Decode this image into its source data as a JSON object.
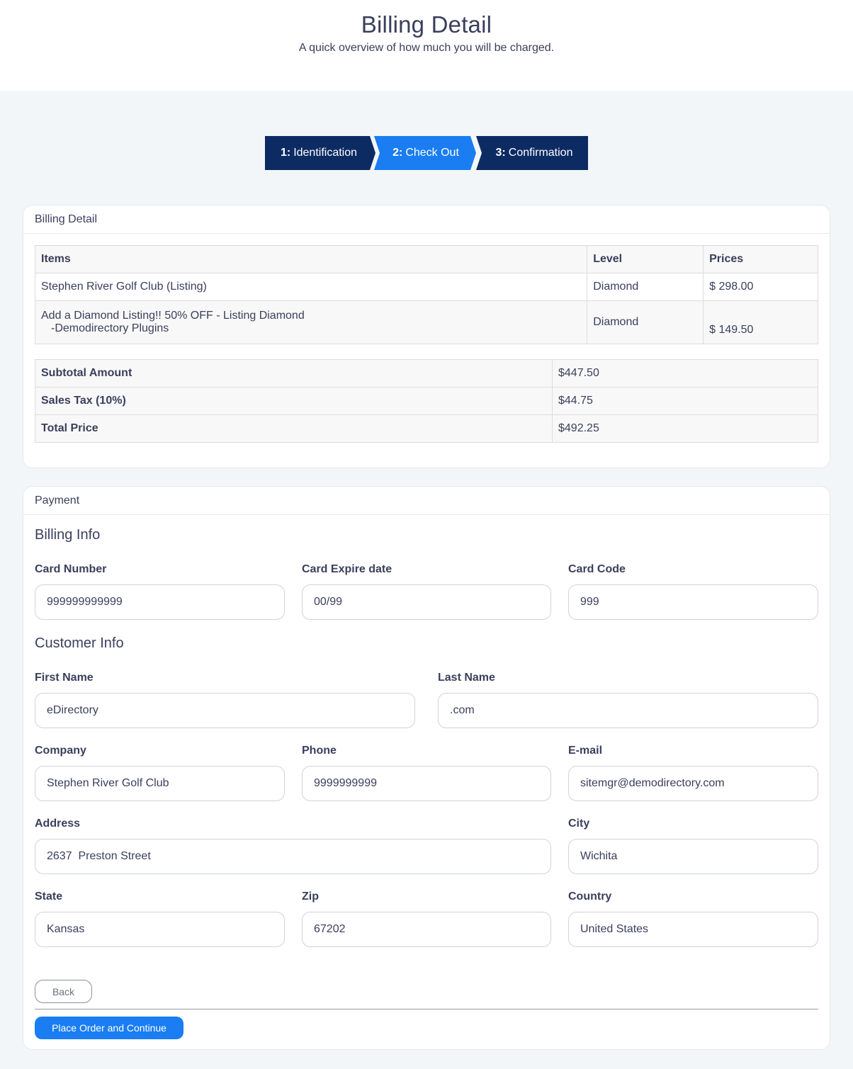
{
  "header": {
    "title": "Billing Detail",
    "subtitle": "A quick overview of how much you will be charged."
  },
  "steps": [
    {
      "number": "1:",
      "label": "Identification",
      "active": false
    },
    {
      "number": "2:",
      "label": "Check Out",
      "active": true
    },
    {
      "number": "3:",
      "label": "Confirmation",
      "active": false
    }
  ],
  "colors": {
    "primary_dark": "#0d2b63",
    "accent": "#1a7df2",
    "text": "#3a3f5c",
    "background": "#f3f6f9"
  },
  "billing_detail": {
    "card_title": "Billing Detail",
    "columns": [
      "Items",
      "Level",
      "Prices"
    ],
    "rows": [
      {
        "item": "Stephen River Golf Club (Listing)",
        "item_sub": "",
        "level": "Diamond",
        "price": "$ 298.00"
      },
      {
        "item": "Add a Diamond Listing!! 50% OFF - Listing Diamond",
        "item_sub": "-Demodirectory Plugins",
        "level": "Diamond",
        "price": "$ 149.50"
      }
    ],
    "totals": [
      {
        "label": "Subtotal Amount",
        "value": "$447.50"
      },
      {
        "label": "Sales Tax (10%)",
        "value": "$44.75"
      },
      {
        "label": "Total Price",
        "value": "$492.25"
      }
    ]
  },
  "payment": {
    "card_title": "Payment",
    "billing_info": {
      "title": "Billing Info",
      "card_number": {
        "label": "Card Number",
        "value": "999999999999"
      },
      "card_expire": {
        "label": "Card Expire date",
        "value": "00/99"
      },
      "card_code": {
        "label": "Card Code",
        "value": "999"
      }
    },
    "customer_info": {
      "title": "Customer Info",
      "first_name": {
        "label": "First Name",
        "value": "eDirectory"
      },
      "last_name": {
        "label": "Last Name",
        "value": ".com"
      },
      "company": {
        "label": "Company",
        "value": "Stephen River Golf Club"
      },
      "phone": {
        "label": "Phone",
        "value": "9999999999"
      },
      "email": {
        "label": "E-mail",
        "value": "sitemgr@demodirectory.com"
      },
      "address": {
        "label": "Address",
        "value": "2637  Preston Street"
      },
      "city": {
        "label": "City",
        "value": "Wichita"
      },
      "state": {
        "label": "State",
        "value": "Kansas"
      },
      "zip": {
        "label": "Zip",
        "value": "67202"
      },
      "country": {
        "label": "Country",
        "value": "United States"
      }
    },
    "back_label": "Back",
    "place_order_label": "Place Order and Continue"
  }
}
